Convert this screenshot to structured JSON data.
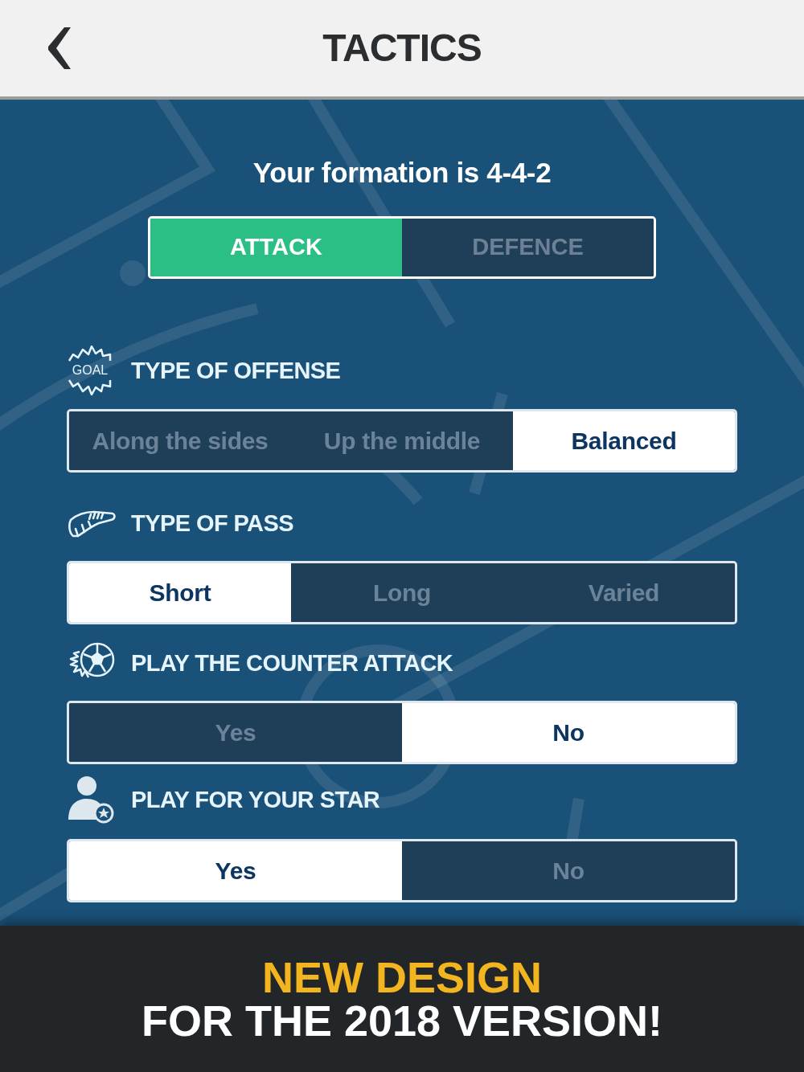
{
  "header": {
    "title": "TACTICS"
  },
  "formation_text": "Your formation is 4-4-2",
  "mode_tabs": [
    {
      "label": "ATTACK",
      "selected": true
    },
    {
      "label": "DEFENCE",
      "selected": false
    }
  ],
  "sections": [
    {
      "kind": "offense",
      "badge_text": "GOAL",
      "title": "TYPE OF OFFENSE",
      "options": [
        {
          "label": "Along the sides",
          "selected": false
        },
        {
          "label": "Up the middle",
          "selected": false
        },
        {
          "label": "Balanced",
          "selected": true
        }
      ]
    },
    {
      "kind": "pass",
      "title": "TYPE OF PASS",
      "options": [
        {
          "label": "Short",
          "selected": true
        },
        {
          "label": "Long",
          "selected": false
        },
        {
          "label": "Varied",
          "selected": false
        }
      ]
    },
    {
      "kind": "counter",
      "title": "PLAY THE COUNTER ATTACK",
      "options": [
        {
          "label": "Yes",
          "selected": false
        },
        {
          "label": "No",
          "selected": true
        }
      ]
    },
    {
      "kind": "star",
      "title": "PLAY FOR YOUR STAR",
      "options": [
        {
          "label": "Yes",
          "selected": true
        },
        {
          "label": "No",
          "selected": false
        }
      ]
    }
  ],
  "promo_banner": {
    "headline": "NEW DESIGN",
    "subline": "FOR THE 2018 VERSION!"
  }
}
